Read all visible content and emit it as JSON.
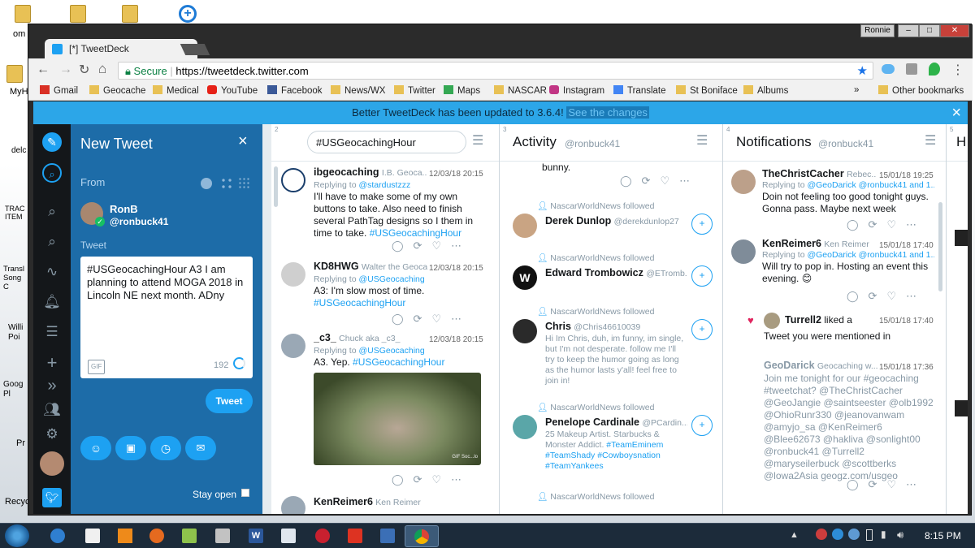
{
  "desktop": {
    "icons": [
      "om",
      "MyH",
      "delc",
      "TRAC ITEM",
      "Transl Song C",
      "Willi Poi",
      "Goog Pl",
      "Pr",
      "Recyc"
    ]
  },
  "browser": {
    "tab_title": "[*] TweetDeck",
    "user_badge": "Ronnie",
    "secure_label": "Secure",
    "url": "https://tweetdeck.twitter.com",
    "bookmarks": [
      "Gmail",
      "Geocache",
      "Medical",
      "YouTube",
      "Facebook",
      "News/WX",
      "Twitter",
      "Maps",
      "NASCAR",
      "Instagram",
      "Translate",
      "St Boniface",
      "Albums"
    ],
    "bookmarks_more": "»",
    "other_bookmarks": "Other bookmarks"
  },
  "banner": {
    "text": "Better TweetDeck has been updated to 3.6.4!",
    "link": "See the changes",
    "close": "×"
  },
  "compose": {
    "title": "New Tweet",
    "close": "×",
    "from_label": "From",
    "user_name": "RonB",
    "user_handle": "@ronbuck41",
    "tweet_label": "Tweet",
    "tweet_text": "#USGeocachingHour  A3  I am planning to attend MOGA 2018 in Lincoln NE next month.  ADny",
    "gif_label": "GIF",
    "char_count": "192",
    "tweet_button": "Tweet",
    "stay_open": "Stay open"
  },
  "columns": {
    "search": {
      "num": "2",
      "query": "#USGeocachingHour",
      "tweets": [
        {
          "name": "ibgeocaching",
          "sub": "I.B. Geoca...",
          "time": "12/03/18 20:15",
          "replying": "Replying to ",
          "replying_to": "@stardustzzz",
          "text": "I'll have to make some of my own buttons to take. Also need to finish several PathTag designs so I them in time to take. ",
          "tag": "#USGeocachingHour"
        },
        {
          "name": "KD8HWG",
          "sub": "Walter the Geoca...",
          "time": "12/03/18 20:15",
          "replying": "Replying to ",
          "replying_to": "@USGeocaching",
          "text": "A3: I'm slow most of time.",
          "tag": "#USGeocachingHour"
        },
        {
          "name": "_c3_",
          "sub": "Chuck aka _c3_",
          "time": "12/03/18 20:15",
          "replying": "Replying to ",
          "replying_to": "@USGeocaching",
          "text": "A3. Yep. ",
          "tag": "#USGeocachingHour",
          "media_caption": "GIF Soc...lo"
        },
        {
          "name": "KenReimer6",
          "sub": "Ken Reimer"
        }
      ]
    },
    "activity": {
      "num": "3",
      "title": "Activity",
      "handle": "@ronbuck41",
      "top_text": "bunny.",
      "items": [
        {
          "followed": "NascarWorldNews followed",
          "name": "Derek Dunlop",
          "handle": "@derekdunlop27"
        },
        {
          "followed": "NascarWorldNews followed",
          "name": "Edward Trombowicz",
          "handle": "@ETromb..."
        },
        {
          "followed": "NascarWorldNews followed",
          "name": "Chris",
          "handle": "@Chris46610039",
          "bio": "Hi Im Chris, duh, im funny, im single, but I'm not desperate. follow me I'll try to keep the humor going as long as the humor lasts y'all! feel free to join in!"
        },
        {
          "followed": "NascarWorldNews followed",
          "name": "Penelope Cardinale",
          "handle": "@PCardin...",
          "bio": "25 Makeup Artist. Starbucks & Monster Addict. ",
          "tags": "#TeamEminem #TeamShady #Cowboysnation #TeamYankees"
        },
        {
          "followed": "NascarWorldNews followed"
        }
      ]
    },
    "notifications": {
      "num": "4",
      "title": "Notifications",
      "handle": "@ronbuck41",
      "items": [
        {
          "name": "TheChristCacher",
          "sub": "Rebec...",
          "time": "15/01/18 19:25",
          "replying": "Replying to ",
          "replying_to": "@GeoDarick @ronbuck41 and 1...",
          "text": "Doin not feeling too good tonight guys. Gonna pass. Maybe next week"
        },
        {
          "name": "KenReimer6",
          "sub": "Ken Reimer",
          "time": "15/01/18 17:40",
          "replying": "Replying to ",
          "replying_to": "@GeoDarick @ronbuck41 and 1...",
          "text": "Will try to pop in.  Hosting an event this evening.  😊"
        },
        {
          "liker": "Turrell2",
          "liked": " liked a",
          "time": "15/01/18 17:40",
          "text": "Tweet you were mentioned in",
          "qname": "GeoDarick",
          "qsub": "Geocaching w...",
          "qtime": "15/01/18 17:36",
          "qtext": "Join me tonight for our #geocaching #tweetchat? @TheChristCacher @GeoJangie @saintseester @olb1992 @OhioRunr330 @jeanovanwam @amyjo_sa @KenReimer6 @Blee62673 @hakliva @sonlight00 @ronbuck41 @Turrell2 @maryseilerbuck @scottberks @lowa2Asia geogz.com/usgeo"
        }
      ]
    },
    "fifth": {
      "num": "5",
      "title": "H"
    }
  },
  "taskbar": {
    "clock": "8:15 PM"
  },
  "colors": {
    "accent": "#1da1f2",
    "compose_bg": "#1d6ca8",
    "banner_bg": "#2ca6e8",
    "rail_bg": "#14171a"
  }
}
